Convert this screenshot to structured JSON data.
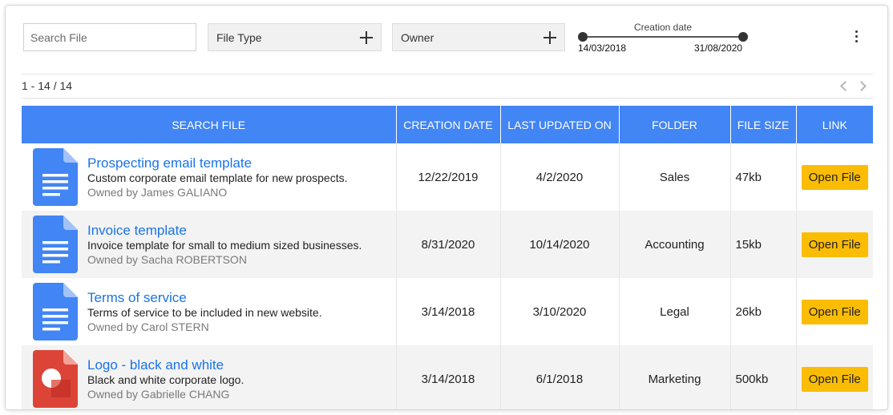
{
  "filters": {
    "search_placeholder": "Search File",
    "file_type_label": "File Type",
    "owner_label": "Owner",
    "date_range": {
      "title": "Creation date",
      "start": "14/03/2018",
      "end": "31/08/2020"
    }
  },
  "pagination": {
    "range_text": "1 - 14 / 14"
  },
  "table": {
    "headers": [
      "SEARCH FILE",
      "CREATION DATE",
      "LAST UPDATED ON",
      "FOLDER",
      "FILE SIZE",
      "LINK"
    ],
    "rows": [
      {
        "icon": "google-docs-icon",
        "title": "Prospecting email template",
        "description": "Custom corporate email template for new prospects.",
        "owner": "Owned by James GALIANO",
        "created": "12/22/2019",
        "updated": "4/2/2020",
        "folder": "Sales",
        "size": "47kb",
        "link_label": "Open File"
      },
      {
        "icon": "google-docs-icon",
        "title": "Invoice template",
        "description": "Invoice template for small to medium sized businesses.",
        "owner": "Owned by Sacha ROBERTSON",
        "created": "8/31/2020",
        "updated": "10/14/2020",
        "folder": "Accounting",
        "size": "15kb",
        "link_label": "Open File"
      },
      {
        "icon": "google-docs-icon",
        "title": "Terms of service",
        "description": "Terms of service to be included in new website.",
        "owner": "Owned by Carol STERN",
        "created": "3/14/2018",
        "updated": "3/10/2020",
        "folder": "Legal",
        "size": "26kb",
        "link_label": "Open File"
      },
      {
        "icon": "google-drawings-icon",
        "title": "Logo - black and white",
        "description": "Black and white corporate logo.",
        "owner": "Owned by Gabrielle CHANG",
        "created": "3/14/2018",
        "updated": "6/1/2018",
        "folder": "Marketing",
        "size": "500kb",
        "link_label": "Open File"
      }
    ]
  },
  "colors": {
    "header_bg": "#4285f4",
    "link_blue": "#1a73e8",
    "button_yellow": "#fbbc04",
    "docs_blue": "#4285f4",
    "drawings_red": "#db4437"
  }
}
